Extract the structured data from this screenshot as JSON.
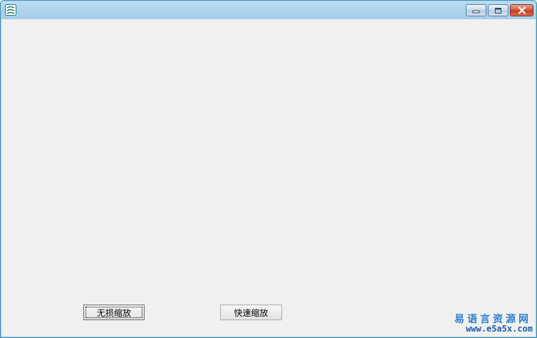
{
  "window": {
    "icon": "app-logo-icon",
    "controls": {
      "minimize_icon": "minimize-icon",
      "maximize_icon": "maximize-icon",
      "close_icon": "close-icon"
    }
  },
  "buttons": {
    "lossless_zoom": "无损缩放",
    "quick_zoom": "快速缩放"
  },
  "watermark": {
    "title": "易语言资源网",
    "url": "www.e5a5x.com"
  },
  "colors": {
    "titlebar": "#a9d2ec",
    "client_bg": "#f0f0f0",
    "close_button": "#c23c25",
    "watermark": "#2f7fcf"
  }
}
